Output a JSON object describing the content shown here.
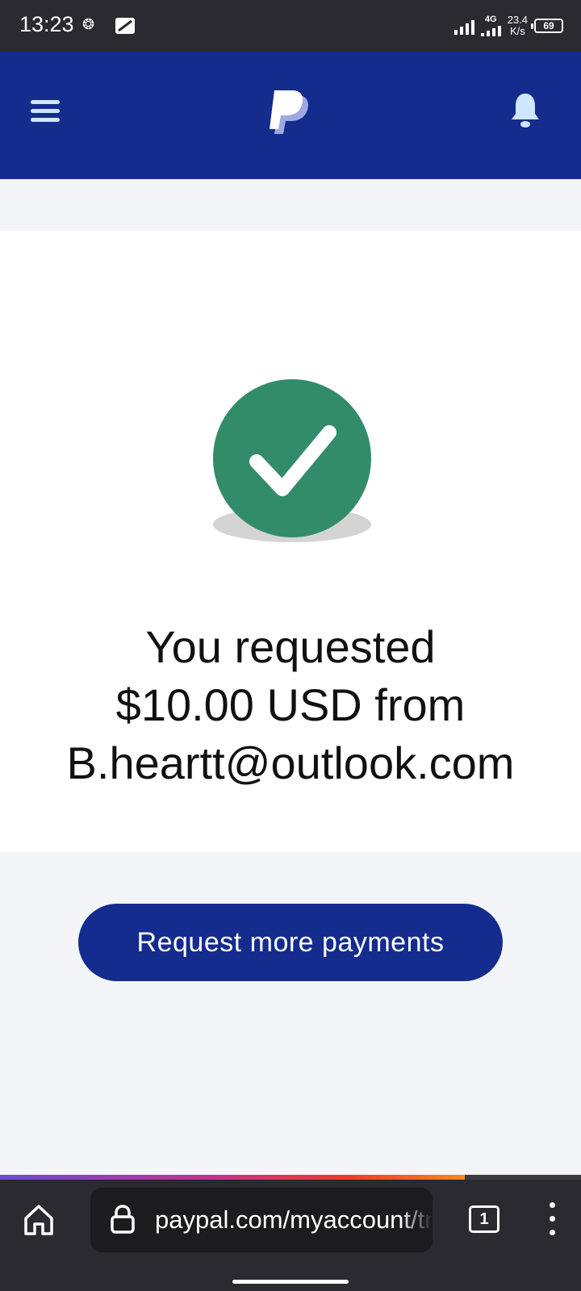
{
  "status_bar": {
    "time": "13:23",
    "network_type": "4G",
    "speed_value": "23.4",
    "speed_unit": "K/s",
    "battery": "69"
  },
  "header": {
    "menu_icon": "hamburger-icon",
    "logo": "paypal-logo",
    "notification_icon": "bell-icon",
    "background_color": "#142c8e"
  },
  "confirmation": {
    "icon": "check-circle-icon",
    "icon_color": "#338c69",
    "line1": "You requested",
    "line2": "$10.00 USD from",
    "line3": "B.heartt@outlook.com"
  },
  "actions": {
    "request_more_label": "Request more payments"
  },
  "browser": {
    "url": "paypal.com/myaccount/tr",
    "tab_count": "1",
    "page_load_progress": 0.8
  }
}
